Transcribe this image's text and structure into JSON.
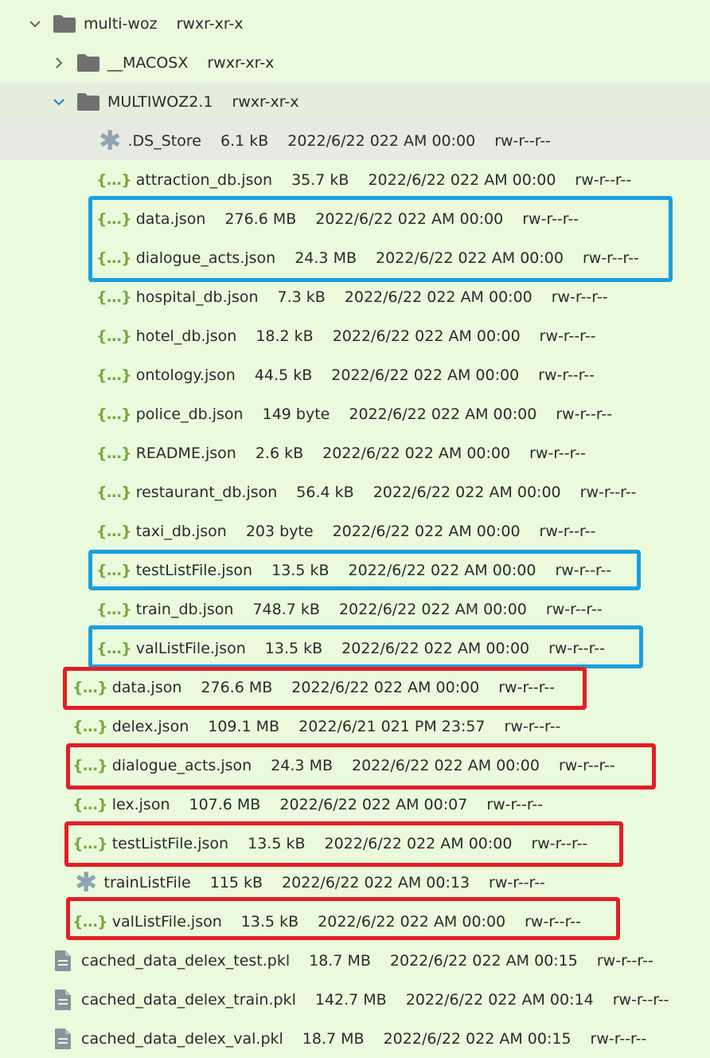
{
  "colors": {
    "blue_box": "#1a9fe0",
    "red_box": "#e31e24",
    "json_icon": "#78a83e",
    "background": "#e9fbdc"
  },
  "rows": [
    {
      "name": "multi-woz",
      "perm": "rwxr-xr-x"
    },
    {
      "name": "__MACOSX",
      "perm": "rwxr-xr-x"
    },
    {
      "name": "MULTIWOZ2.1",
      "perm": "rwxr-xr-x"
    },
    {
      "name": ".DS_Store",
      "size": "6.1 kB",
      "date": "2022/6/22 022 AM 00:00",
      "perm": "rw-r--r--",
      "icon": "asterisk-icon"
    },
    {
      "name": "attraction_db.json",
      "size": "35.7 kB",
      "date": "2022/6/22 022 AM 00:00",
      "perm": "rw-r--r--",
      "icon": "json-icon"
    },
    {
      "name": "data.json",
      "size": "276.6 MB",
      "date": "2022/6/22 022 AM 00:00",
      "perm": "rw-r--r--",
      "icon": "json-icon"
    },
    {
      "name": "dialogue_acts.json",
      "size": "24.3 MB",
      "date": "2022/6/22 022 AM 00:00",
      "perm": "rw-r--r--",
      "icon": "json-icon"
    },
    {
      "name": "hospital_db.json",
      "size": "7.3 kB",
      "date": "2022/6/22 022 AM 00:00",
      "perm": "rw-r--r--",
      "icon": "json-icon"
    },
    {
      "name": "hotel_db.json",
      "size": "18.2 kB",
      "date": "2022/6/22 022 AM 00:00",
      "perm": "rw-r--r--",
      "icon": "json-icon"
    },
    {
      "name": "ontology.json",
      "size": "44.5 kB",
      "date": "2022/6/22 022 AM 00:00",
      "perm": "rw-r--r--",
      "icon": "json-icon"
    },
    {
      "name": "police_db.json",
      "size": "149 byte",
      "date": "2022/6/22 022 AM 00:00",
      "perm": "rw-r--r--",
      "icon": "json-icon"
    },
    {
      "name": "README.json",
      "size": "2.6 kB",
      "date": "2022/6/22 022 AM 00:00",
      "perm": "rw-r--r--",
      "icon": "json-icon"
    },
    {
      "name": "restaurant_db.json",
      "size": "56.4 kB",
      "date": "2022/6/22 022 AM 00:00",
      "perm": "rw-r--r--",
      "icon": "json-icon"
    },
    {
      "name": "taxi_db.json",
      "size": "203 byte",
      "date": "2022/6/22 022 AM 00:00",
      "perm": "rw-r--r--",
      "icon": "json-icon"
    },
    {
      "name": "testListFile.json",
      "size": "13.5 kB",
      "date": "2022/6/22 022 AM 00:00",
      "perm": "rw-r--r--",
      "icon": "json-icon"
    },
    {
      "name": "train_db.json",
      "size": "748.7 kB",
      "date": "2022/6/22 022 AM 00:00",
      "perm": "rw-r--r--",
      "icon": "json-icon"
    },
    {
      "name": "valListFile.json",
      "size": "13.5 kB",
      "date": "2022/6/22 022 AM 00:00",
      "perm": "rw-r--r--",
      "icon": "json-icon"
    },
    {
      "name": "data.json",
      "size": "276.6 MB",
      "date": "2022/6/22 022 AM 00:00",
      "perm": "rw-r--r--",
      "icon": "json-icon"
    },
    {
      "name": "delex.json",
      "size": "109.1 MB",
      "date": "2022/6/21 021 PM 23:57",
      "perm": "rw-r--r--",
      "icon": "json-icon"
    },
    {
      "name": "dialogue_acts.json",
      "size": "24.3 MB",
      "date": "2022/6/22 022 AM 00:00",
      "perm": "rw-r--r--",
      "icon": "json-icon"
    },
    {
      "name": "lex.json",
      "size": "107.6 MB",
      "date": "2022/6/22 022 AM 00:07",
      "perm": "rw-r--r--",
      "icon": "json-icon"
    },
    {
      "name": "testListFile.json",
      "size": "13.5 kB",
      "date": "2022/6/22 022 AM 00:00",
      "perm": "rw-r--r--",
      "icon": "json-icon"
    },
    {
      "name": "trainListFile",
      "size": "115 kB",
      "date": "2022/6/22 022 AM 00:13",
      "perm": "rw-r--r--",
      "icon": "asterisk-icon"
    },
    {
      "name": "valListFile.json",
      "size": "13.5 kB",
      "date": "2022/6/22 022 AM 00:00",
      "perm": "rw-r--r--",
      "icon": "json-icon"
    },
    {
      "name": "cached_data_delex_test.pkl",
      "size": "18.7 MB",
      "date": "2022/6/22 022 AM 00:15",
      "perm": "rw-r--r--",
      "icon": "file-icon"
    },
    {
      "name": "cached_data_delex_train.pkl",
      "size": "142.7 MB",
      "date": "2022/6/22 022 AM 00:14",
      "perm": "rw-r--r--",
      "icon": "file-icon"
    },
    {
      "name": "cached_data_delex_val.pkl",
      "size": "18.7 MB",
      "date": "2022/6/22 022 AM 00:15",
      "perm": "rw-r--r--",
      "icon": "file-icon"
    }
  ]
}
